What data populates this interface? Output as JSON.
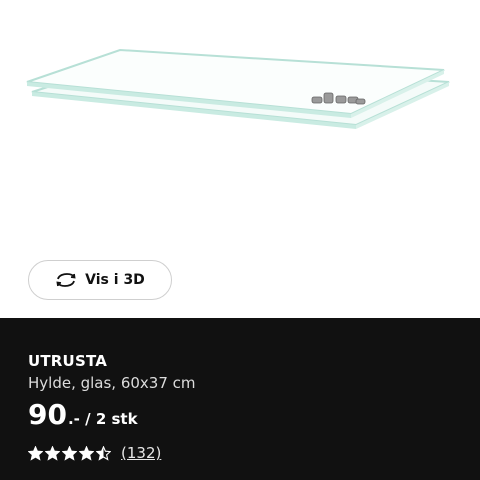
{
  "view3d": {
    "label": "Vis i 3D",
    "icon": "rotate-3d-icon"
  },
  "product": {
    "name": "UTRUSTA",
    "description": "Hylde, glas, 60x37 cm",
    "price_integer": "90",
    "price_suffix": ".- / 2 stk",
    "rating": 4.5,
    "rating_max": 5,
    "review_count": "(132)"
  },
  "colors": {
    "panel_bg": "#111111",
    "text": "#ffffff",
    "glass_edge": "#b7e0d6"
  }
}
